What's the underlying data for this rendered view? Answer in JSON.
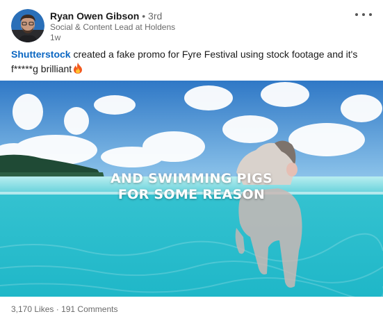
{
  "post": {
    "actor": {
      "name": "Ryan Owen Gibson",
      "degree": "• 3rd",
      "headline": "Social & Content Lead at Holdens",
      "time": "1w",
      "avatar": "avatar-photo"
    },
    "menu_icon": "ellipsis-icon",
    "commentary": {
      "mention": "Shutterstock",
      "text": " created a fake promo for Fyre Festival using stock footage and it's f*****g brilliant",
      "emoji": "fire-emoji-icon"
    },
    "media": {
      "caption_line1": "AND SWIMMING PIGS",
      "caption_line2": "FOR SOME REASON"
    },
    "social_counts": {
      "likes": "3,170 Likes",
      "separator": "·",
      "comments": "191 Comments"
    }
  },
  "colors": {
    "link_blue": "#0a66c2",
    "secondary_text": "#666666",
    "water": "#2ec8d6",
    "sky": "#3f8fd6"
  }
}
